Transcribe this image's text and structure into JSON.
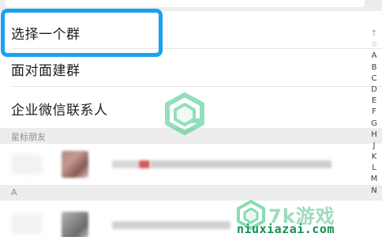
{
  "menu": {
    "items": [
      {
        "label": "选择一个群"
      },
      {
        "label": "面对面建群"
      },
      {
        "label": "企业微信联系人"
      }
    ]
  },
  "sections": {
    "starred": {
      "header": "星标朋友"
    },
    "a": {
      "header": "A"
    }
  },
  "index_bar": {
    "letters": [
      "↑",
      "☆",
      "A",
      "B",
      "C",
      "D",
      "E",
      "F",
      "G",
      "H",
      "J",
      "K",
      "L",
      "M",
      "N"
    ]
  },
  "watermark": {
    "brand": "7k游戏",
    "url": "niuxiazai.com"
  },
  "colors": {
    "highlight": "#1aa1f1",
    "watermark_green": "#12914f"
  }
}
